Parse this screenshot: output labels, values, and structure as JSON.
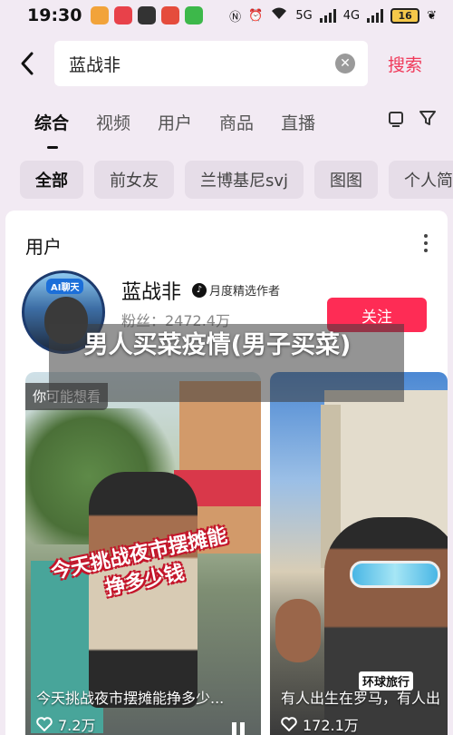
{
  "status_bar": {
    "time": "19:30",
    "network": "5G",
    "network2": "4G",
    "battery": "16"
  },
  "search": {
    "query": "蓝战非",
    "action_label": "搜索"
  },
  "tabs": [
    {
      "label": "综合"
    },
    {
      "label": "视频"
    },
    {
      "label": "用户"
    },
    {
      "label": "商品"
    },
    {
      "label": "直播"
    }
  ],
  "chips": [
    {
      "label": "全部"
    },
    {
      "label": "前女友"
    },
    {
      "label": "兰博基尼svj"
    },
    {
      "label": "图图"
    },
    {
      "label": "个人简"
    }
  ],
  "user_section": {
    "title": "用户",
    "user": {
      "name": "蓝战非",
      "avatar_badge": "AI聊天",
      "verify_label": "月度精选作者",
      "fans": "粉丝：2472.4万",
      "follow_label": "关注"
    }
  },
  "maybe_label": "你可能想看",
  "videos": [
    {
      "overlay_title": "今天挑战夜市摆摊能挣多少钱",
      "caption": "今天挑战夜市摆摊能挣多少...",
      "likes": "7.2万"
    },
    {
      "tag": "环球旅行",
      "caption": "有人出生在罗马，有人出",
      "likes": "172.1万"
    }
  ],
  "watermark": "男人买菜疫情(男子买菜)",
  "colors": {
    "accent": "#fe2c55",
    "search_action": "#f03a5a",
    "page_bg": "#f2eaf3"
  }
}
